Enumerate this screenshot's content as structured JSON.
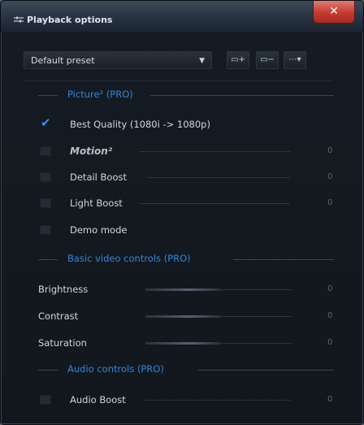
{
  "window": {
    "title": "Playback options",
    "close_glyph": "✕"
  },
  "toolbar": {
    "preset": "Default preset",
    "buttons": [
      {
        "name": "save-preset-button",
        "glyph": "▭+"
      },
      {
        "name": "delete-preset-button",
        "glyph": "▭−"
      },
      {
        "name": "preset-options-button",
        "glyph": "⋯▾"
      }
    ]
  },
  "sections": {
    "picture": "Picture² (PRO)",
    "basic_video": "Basic video controls (PRO)",
    "audio": "Audio controls (PRO)"
  },
  "picture": {
    "best_quality": {
      "label": "Best Quality (1080i -> 1080p)",
      "checked": true
    },
    "motion": {
      "label": "Motion²",
      "value": "0",
      "checked": false
    },
    "detail_boost": {
      "label": "Detail Boost",
      "value": "0",
      "checked": false
    },
    "light_boost": {
      "label": "Light Boost",
      "value": "0",
      "checked": false
    },
    "demo_mode": {
      "label": "Demo mode",
      "checked": false
    }
  },
  "video": {
    "brightness": {
      "label": "Brightness",
      "value": "0"
    },
    "contrast": {
      "label": "Contrast",
      "value": "0"
    },
    "saturation": {
      "label": "Saturation",
      "value": "0"
    }
  },
  "audio": {
    "audio_boost": {
      "label": "Audio Boost",
      "value": "0",
      "checked": false
    }
  },
  "colors": {
    "accent": "#2f86e0",
    "close": "#c23b2f"
  }
}
